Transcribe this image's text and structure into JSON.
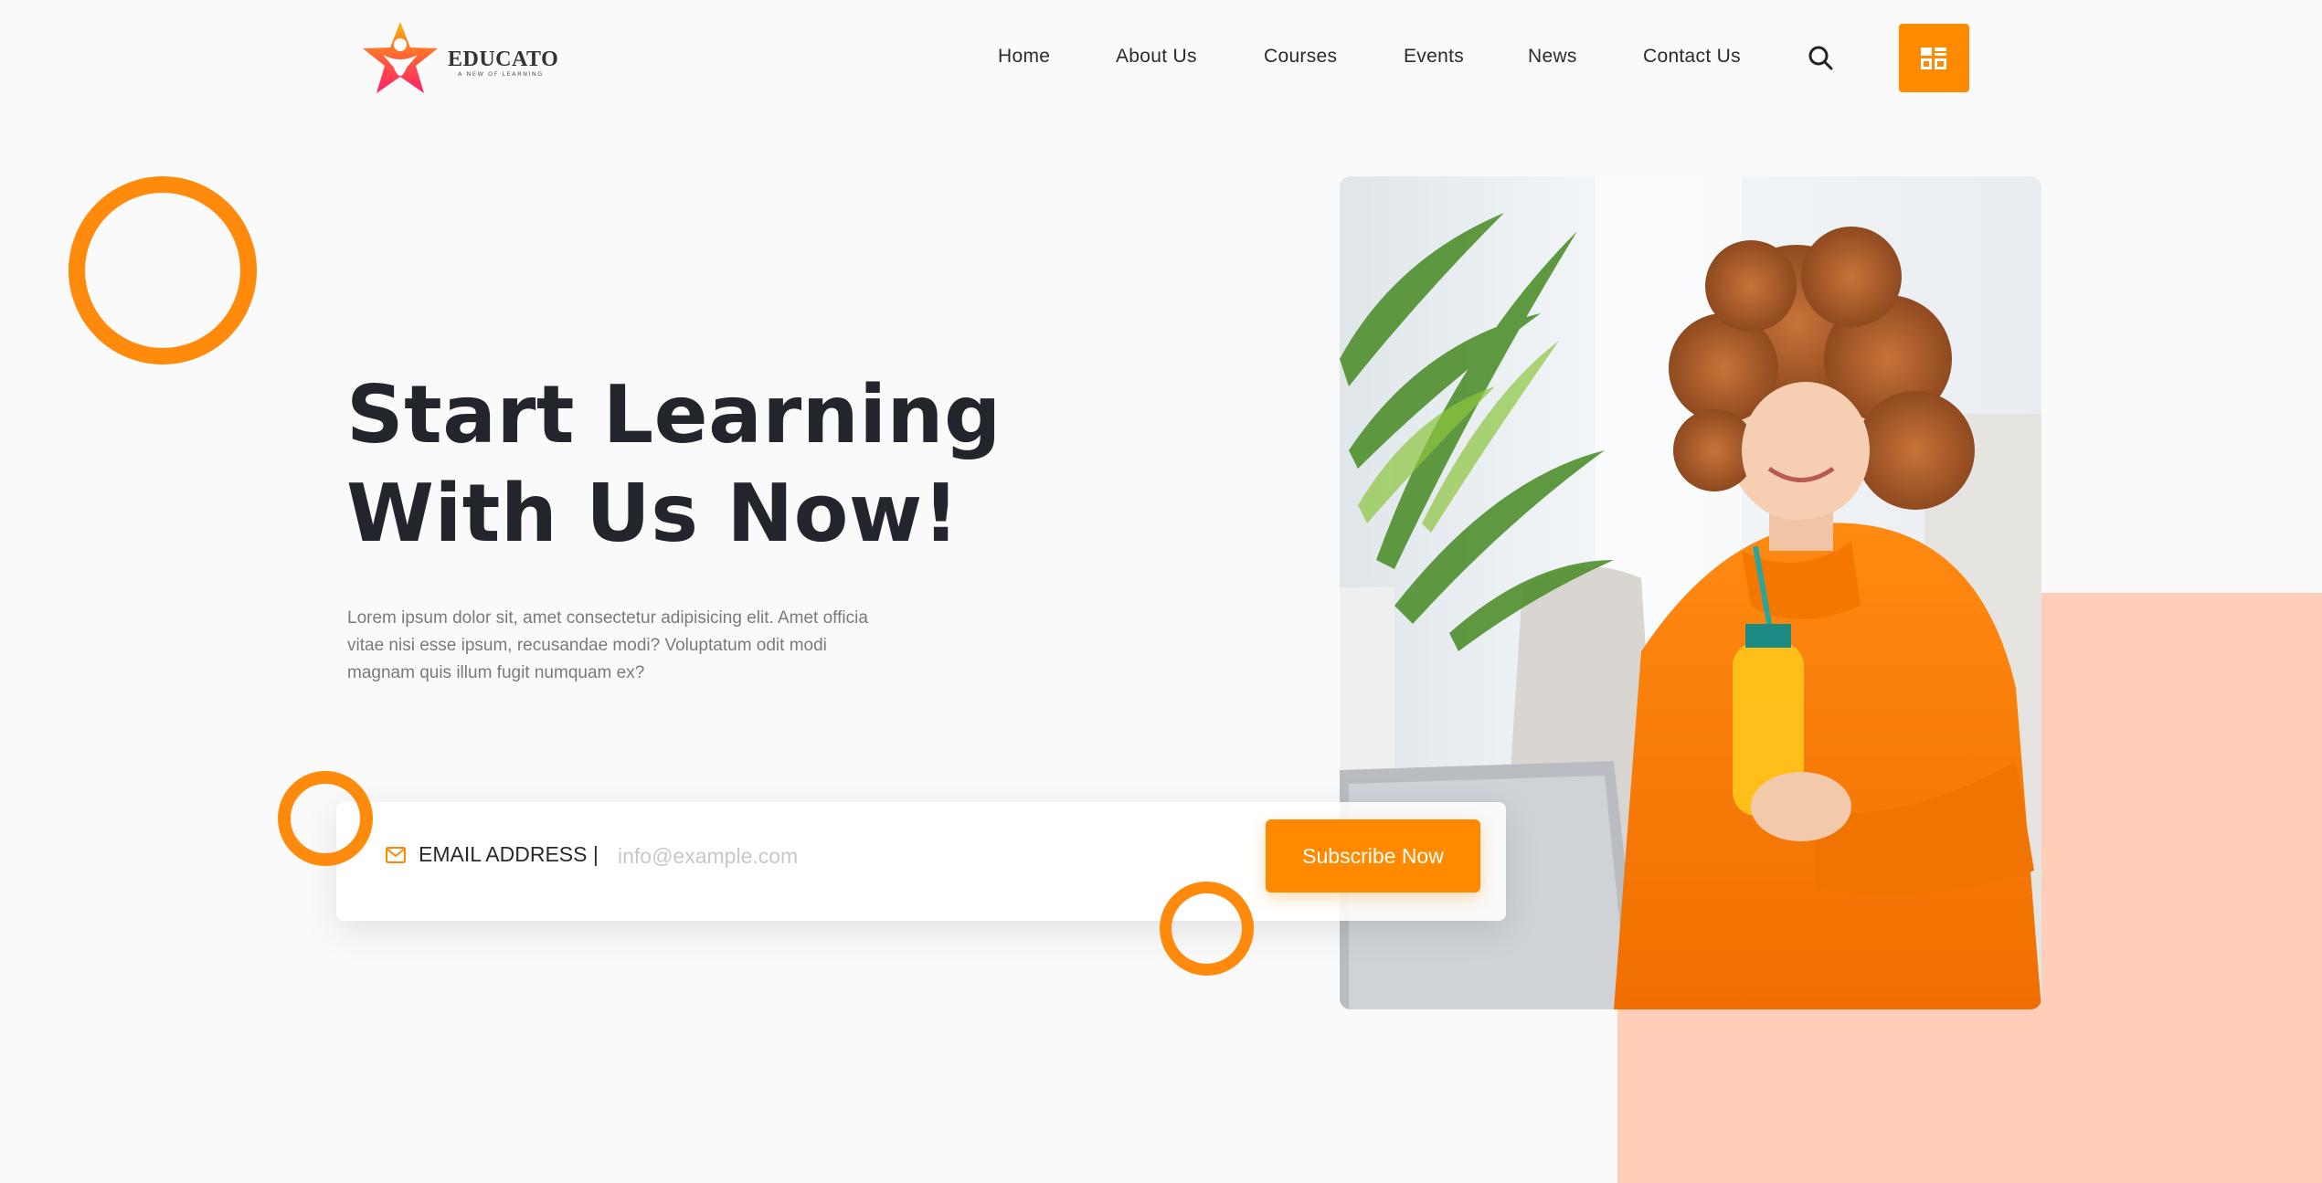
{
  "brand": {
    "name": "EDUCATO",
    "tagline": "A NEW OF LEARNING",
    "logo_icon": "star-person-icon"
  },
  "nav": {
    "items": [
      {
        "label": "Home"
      },
      {
        "label": "About Us"
      },
      {
        "label": "Courses"
      },
      {
        "label": "Events"
      },
      {
        "label": "News"
      },
      {
        "label": "Contact Us"
      }
    ],
    "search_icon": "search-icon",
    "menu_icon": "grid-menu-icon"
  },
  "hero": {
    "title_line1": "Start Learning",
    "title_line2": "With Us Now!",
    "description": "Lorem ipsum dolor sit, amet consectetur adipisicing elit. Amet officia vitae nisi esse ipsum, recusandae modi? Voluptatum odit modi magnam quis illum fugit numquam ex?"
  },
  "subscribe": {
    "label": "EMAIL ADDRESS |",
    "placeholder": "info@example.com",
    "value": "",
    "button_label": "Subscribe Now",
    "icon": "mail-icon"
  },
  "image": {
    "subject": "woman-in-orange-sweater-with-juice"
  },
  "colors": {
    "accent": "#ff8a00",
    "peach": "#ffcdb8",
    "heading": "#22262c",
    "body_text": "#7a7a7a",
    "background": "#fafafa"
  }
}
